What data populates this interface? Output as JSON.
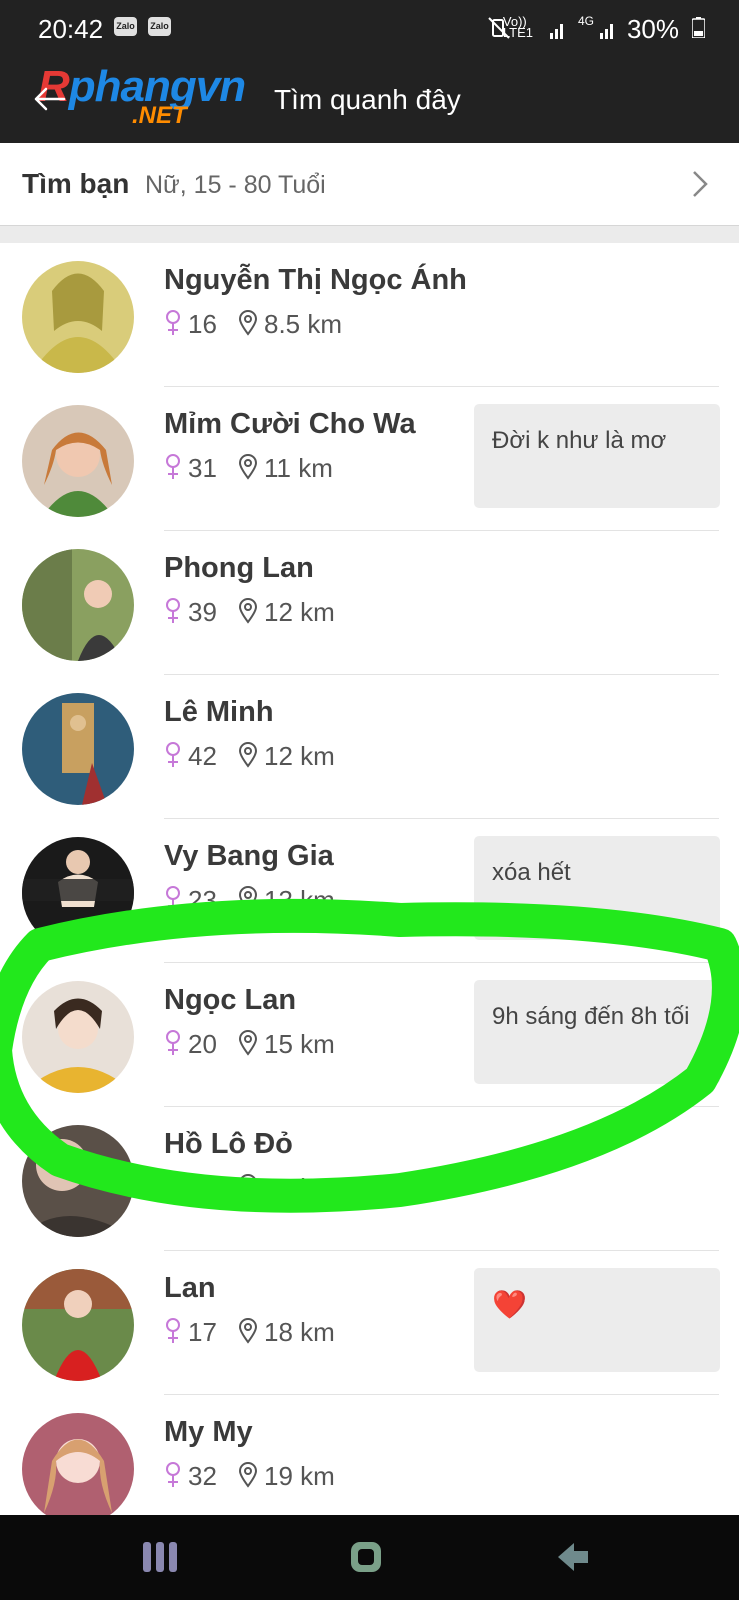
{
  "status_bar": {
    "time": "20:42",
    "notifications": [
      "Zalo",
      "Zalo"
    ],
    "network_top": "Vo))",
    "network_bottom": "LTE1",
    "net_4g": "4G",
    "battery": "30%"
  },
  "app_bar": {
    "logo_main_prefix": "R",
    "logo_main_rest": "phangvn",
    "logo_sub": ".NET",
    "title": "Tìm quanh đây"
  },
  "filter": {
    "title": "Tìm bạn",
    "value": "Nữ, 15 - 80 Tuổi"
  },
  "users": [
    {
      "name": "Nguyễn Thị Ngọc Ánh",
      "age": "16",
      "distance": "8.5 km",
      "status": ""
    },
    {
      "name": "Mỉm Cười Cho Wa",
      "age": "31",
      "distance": "11 km",
      "status": "Đời k như là mơ"
    },
    {
      "name": "Phong Lan",
      "age": "39",
      "distance": "12 km",
      "status": ""
    },
    {
      "name": "Lê Minh",
      "age": "42",
      "distance": "12 km",
      "status": ""
    },
    {
      "name": "Vy Bang Gia",
      "age": "23",
      "distance": "13 km",
      "status": "xóa hết"
    },
    {
      "name": "Ngọc Lan",
      "age": "20",
      "distance": "15 km",
      "status": "9h sáng đến 8h tối"
    },
    {
      "name": "Hồ Lô Đỏ",
      "age": "25",
      "distance": "17 km",
      "status": ""
    },
    {
      "name": "Lan",
      "age": "17",
      "distance": "18 km",
      "status": "❤️"
    },
    {
      "name": "My My",
      "age": "32",
      "distance": "19 km",
      "status": ""
    }
  ],
  "colors": {
    "bar": "#222222",
    "female": "#c678d8",
    "highlight": "#22e81c"
  }
}
